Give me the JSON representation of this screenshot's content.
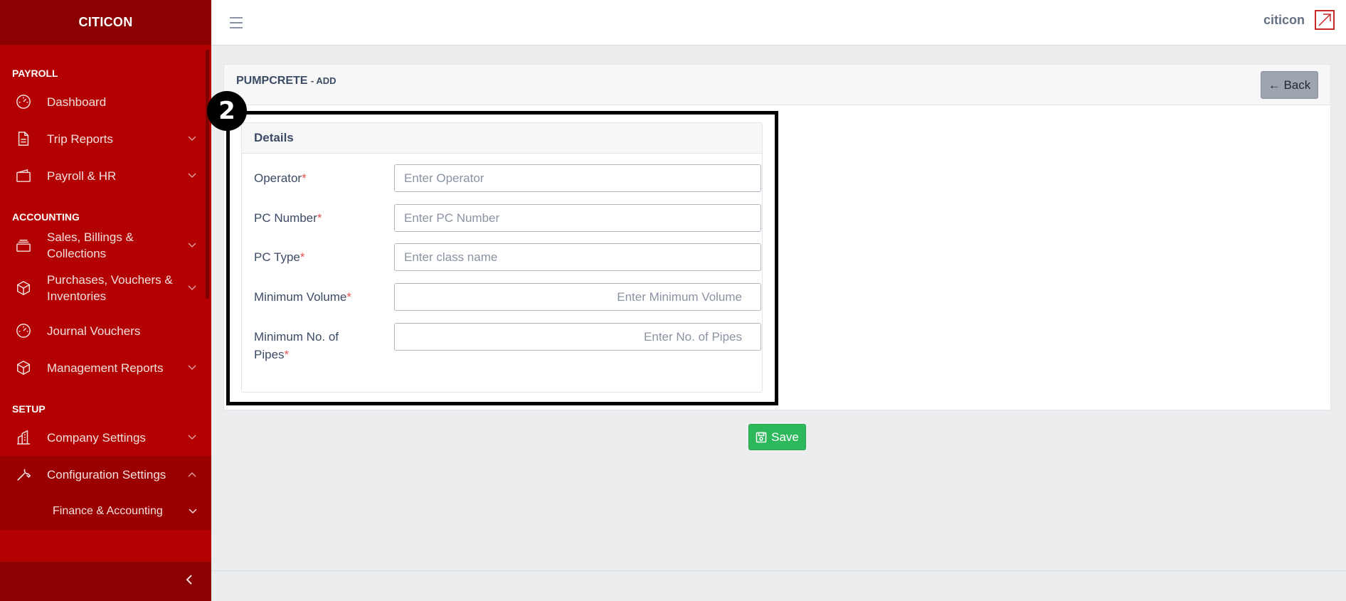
{
  "sidebar": {
    "brand": "CITICON",
    "sections": [
      {
        "title": "PAYROLL",
        "items": [
          {
            "label": "Dashboard",
            "icon": "speedometer-icon",
            "has_children": false
          },
          {
            "label": "Trip Reports",
            "icon": "file-icon",
            "has_children": true
          },
          {
            "label": "Payroll & HR",
            "icon": "wallet-icon",
            "has_children": true
          }
        ]
      },
      {
        "title": "ACCOUNTING",
        "items": [
          {
            "label": "Sales, Billings & Collections",
            "icon": "layers-icon",
            "has_children": true
          },
          {
            "label": "Purchases, Vouchers & Inventories",
            "icon": "cube-icon",
            "has_children": true
          },
          {
            "label": "Journal Vouchers",
            "icon": "speedometer-icon",
            "has_children": false
          },
          {
            "label": "Management Reports",
            "icon": "cube-icon",
            "has_children": true
          }
        ]
      },
      {
        "title": "SETUP",
        "items": [
          {
            "label": "Company Settings",
            "icon": "building-icon",
            "has_children": true
          },
          {
            "label": "Configuration Settings",
            "icon": "wrench-icon",
            "has_children": true,
            "expanded": true
          },
          {
            "label": "Finance & Accounting",
            "has_children": true,
            "sub": true
          }
        ]
      }
    ]
  },
  "header": {
    "username": "citicon"
  },
  "page": {
    "title": "PUMPCRETE",
    "subtitle": "- ADD",
    "back_label": "← Back",
    "details_title": "Details",
    "annotation_number": "2",
    "save_label": "Save"
  },
  "form": {
    "fields": [
      {
        "label": "Operator",
        "placeholder": "Enter Operator",
        "value": "",
        "required": "*"
      },
      {
        "label": "PC Number",
        "placeholder": "Enter PC Number",
        "value": "",
        "required": "*"
      },
      {
        "label": "PC Type",
        "placeholder": "Enter class name",
        "value": "",
        "required": "*"
      },
      {
        "label": "Minimum Volume",
        "placeholder": "Enter Minimum Volume",
        "value": "",
        "required": "*"
      },
      {
        "label": "Minimum No. of Pipes",
        "placeholder": "Enter No. of Pipes",
        "value": "",
        "required": "*"
      }
    ]
  },
  "colors": {
    "sidebar_bg": "#b30000",
    "brand_bg": "#8b0000",
    "save_green": "#2eb85c",
    "back_gray": "#9da5b1",
    "required_red": "#e55353"
  }
}
